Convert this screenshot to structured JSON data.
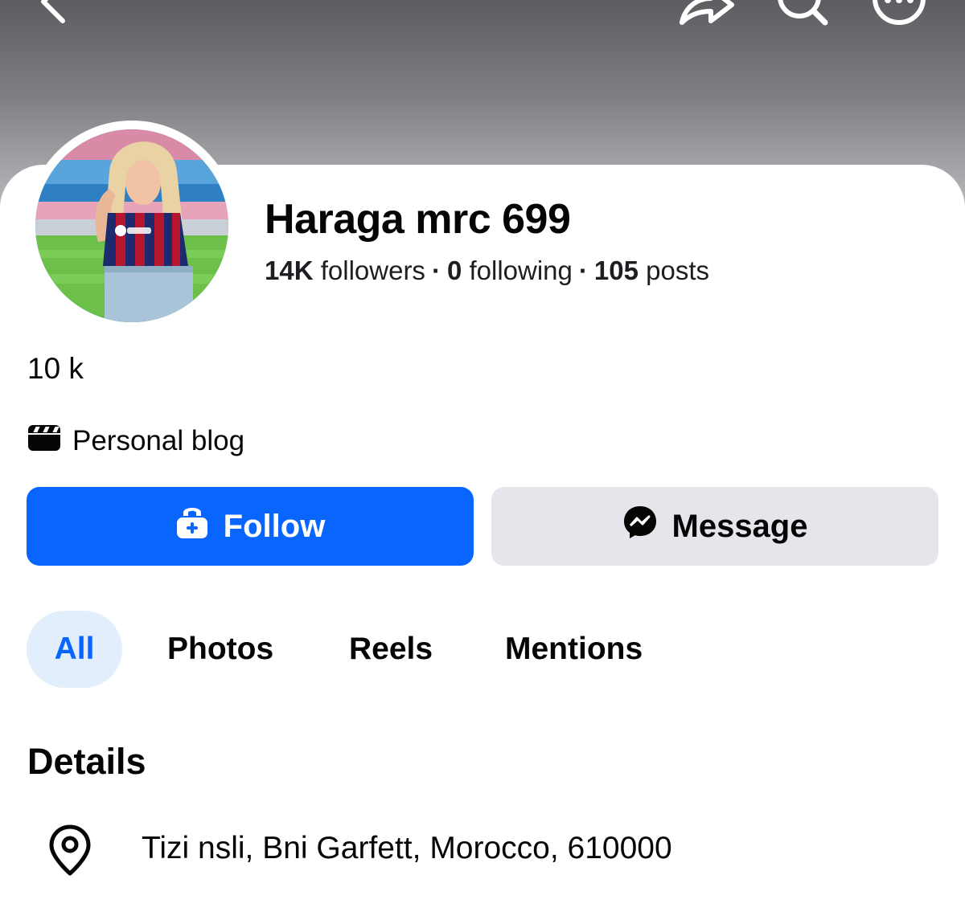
{
  "topbar": {
    "back_icon": "chevron-left-icon",
    "share_icon": "share-icon",
    "search_icon": "search-icon",
    "more_icon": "more-options-icon"
  },
  "profile": {
    "name": "Haraga mrc 699",
    "followers_count": "14K",
    "followers_label": "followers",
    "following_count": "0",
    "following_label": "following",
    "posts_count": "105",
    "posts_label": "posts",
    "separator": "·",
    "bio": "10 k",
    "category": "Personal blog",
    "category_icon": "clapperboard-icon"
  },
  "actions": {
    "follow_label": "Follow",
    "follow_icon": "add-user-icon",
    "message_label": "Message",
    "message_icon": "messenger-icon"
  },
  "tabs": [
    {
      "label": "All",
      "active": true
    },
    {
      "label": "Photos",
      "active": false
    },
    {
      "label": "Reels",
      "active": false
    },
    {
      "label": "Mentions",
      "active": false
    }
  ],
  "details": {
    "title": "Details",
    "location": "Tizi nsli, Bni Garfett, Morocco, 610000",
    "location_icon": "location-pin-icon"
  },
  "colors": {
    "accent": "#0866ff",
    "tab_active_bg": "#e2eefc",
    "secondary_button": "#e4e6eb"
  }
}
